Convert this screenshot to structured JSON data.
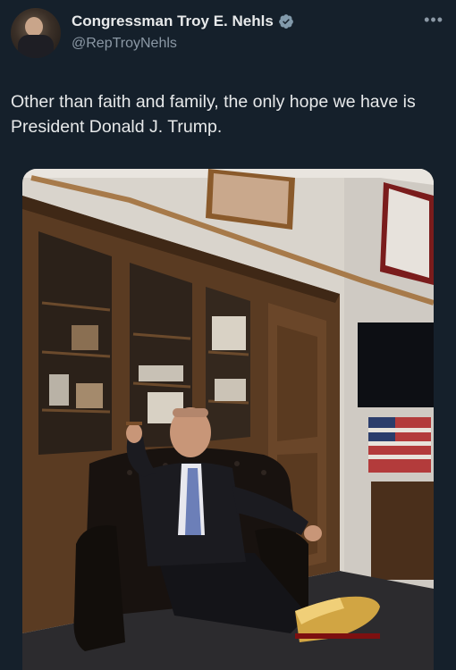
{
  "author": {
    "display_name": "Congressman Troy E. Nehls",
    "handle": "@RepTroyNehls",
    "verified": true
  },
  "tweet": {
    "text": "Other than faith and family, the only hope we have is President Donald J. Trump."
  },
  "icons": {
    "verified": "verified-badge-icon",
    "more": "more-options-icon"
  },
  "colors": {
    "background": "#15202b",
    "text_primary": "#e7e9ea",
    "text_secondary": "#8b98a5",
    "verified_badge": "#829aab"
  }
}
